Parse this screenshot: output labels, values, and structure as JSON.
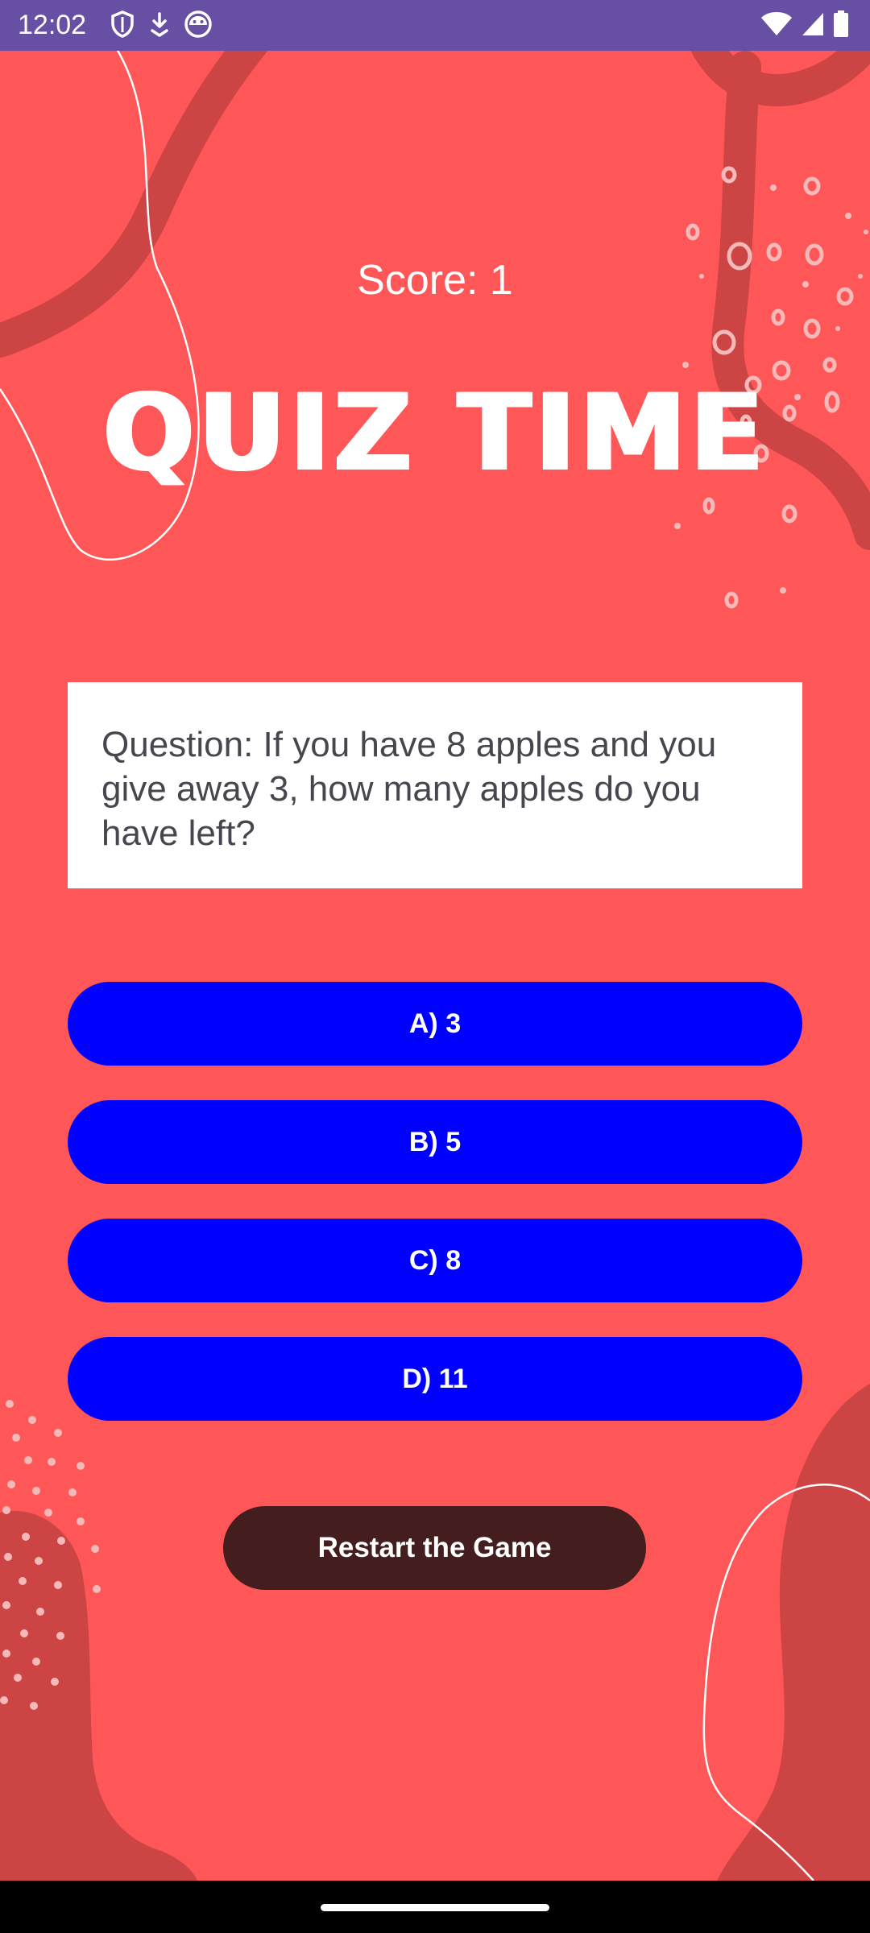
{
  "status_bar": {
    "time": "12:02",
    "left_icons": [
      "shield-icon",
      "download-icon",
      "android-face-icon"
    ],
    "right_icons": [
      "wifi-icon",
      "cell-signal-icon",
      "battery-icon"
    ],
    "background": "#6750A4"
  },
  "quiz": {
    "score_text": "Score: 1",
    "title": "QUIZ TIME",
    "question": "Question: If you have 8 apples and you give away 3, how many apples do you have left?",
    "options": [
      {
        "label": "A) 3"
      },
      {
        "label": "B) 5"
      },
      {
        "label": "C) 8"
      },
      {
        "label": "D) 11"
      }
    ],
    "restart_label": "Restart the Game"
  },
  "colors": {
    "background": "#FF5757",
    "decor": "#CC4444",
    "option_button": "#0000FF",
    "restart_button": "#441E1E",
    "question_card": "#FFFFFF"
  }
}
